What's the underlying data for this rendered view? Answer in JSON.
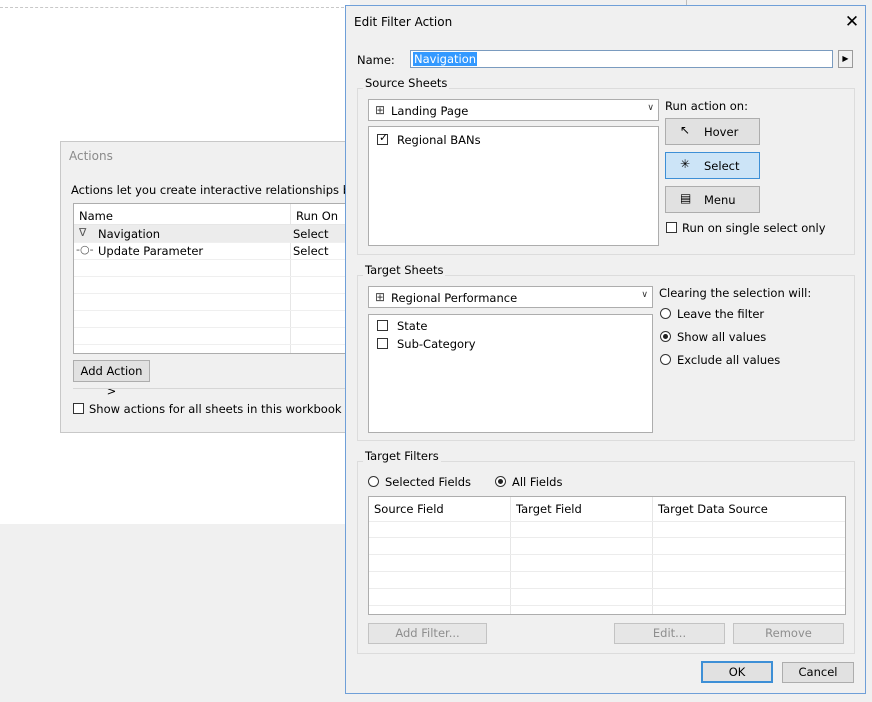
{
  "background": {
    "actions_dialog": {
      "title": "Actions",
      "description": "Actions let you create interactive relationships between d",
      "columns": {
        "name": "Name",
        "run_on": "Run On"
      },
      "rows": [
        {
          "icon": "filter-icon",
          "glyph": "∇",
          "name": "Navigation",
          "run_on": "Select"
        },
        {
          "icon": "parameter-icon",
          "glyph": "-○-",
          "name": "Update Parameter",
          "run_on": "Select"
        }
      ],
      "add_action_label": "Add Action >",
      "show_all_label": "Show actions for all sheets in this workbook"
    }
  },
  "dialog": {
    "title": "Edit Filter Action",
    "close_glyph": "✕",
    "name_label": "Name:",
    "name_value": "Navigation",
    "name_insert_glyph": "▶",
    "source": {
      "group_label": "Source Sheets",
      "selected_sheet": "Landing Page",
      "sheets": [
        {
          "label": "Regional BANs",
          "checked": true
        }
      ],
      "run_action_label": "Run action on:",
      "hover_label": "Hover",
      "select_label": "Select",
      "menu_label": "Menu",
      "run_single_label": "Run on single select only"
    },
    "target": {
      "group_label": "Target Sheets",
      "selected_sheet": "Regional Performance",
      "sheets": [
        {
          "label": "State",
          "checked": false
        },
        {
          "label": "Sub-Category",
          "checked": false
        }
      ],
      "clearing_label": "Clearing the selection will:",
      "options": [
        "Leave the filter",
        "Show all values",
        "Exclude all values"
      ],
      "selected_option": "Show all values"
    },
    "filters": {
      "group_label": "Target Filters",
      "selected_fields_label": "Selected Fields",
      "all_fields_label": "All Fields",
      "selected_mode": "All Fields",
      "columns": [
        "Source Field",
        "Target Field",
        "Target Data Source"
      ],
      "add_filter_label": "Add Filter...",
      "edit_label": "Edit...",
      "remove_label": "Remove"
    },
    "ok_label": "OK",
    "cancel_label": "Cancel"
  },
  "colors": {
    "accent": "#3399ff",
    "selected_button": "#cce4f7"
  }
}
